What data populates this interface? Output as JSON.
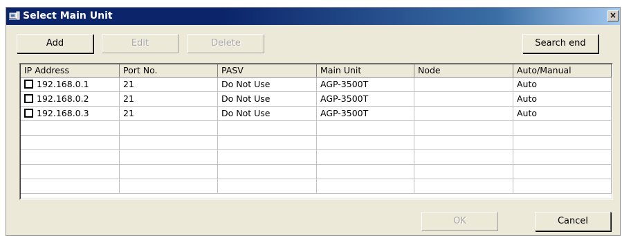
{
  "window": {
    "title": "Select Main Unit",
    "close_label": "×"
  },
  "toolbar": {
    "add_label": "Add",
    "edit_label": "Edit",
    "delete_label": "Delete",
    "search_end_label": "Search end"
  },
  "table": {
    "columns": [
      "IP Address",
      "Port No.",
      "PASV",
      "Main Unit",
      "Node",
      "Auto/Manual"
    ],
    "rows": [
      {
        "checked": false,
        "ip": "192.168.0.1",
        "port": "21",
        "pasv": "Do Not Use",
        "main_unit": "AGP-3500T",
        "node": "",
        "mode": "Auto"
      },
      {
        "checked": false,
        "ip": "192.168.0.2",
        "port": "21",
        "pasv": "Do Not Use",
        "main_unit": "AGP-3500T",
        "node": "",
        "mode": "Auto"
      },
      {
        "checked": false,
        "ip": "192.168.0.3",
        "port": "21",
        "pasv": "Do Not Use",
        "main_unit": "AGP-3500T",
        "node": "",
        "mode": "Auto"
      }
    ]
  },
  "footer": {
    "ok_label": "OK",
    "cancel_label": "Cancel"
  },
  "colors": {
    "title_bar_start": "#0b246a",
    "title_bar_end": "#a6caf0",
    "dialog_bg": "#ece9d8"
  }
}
